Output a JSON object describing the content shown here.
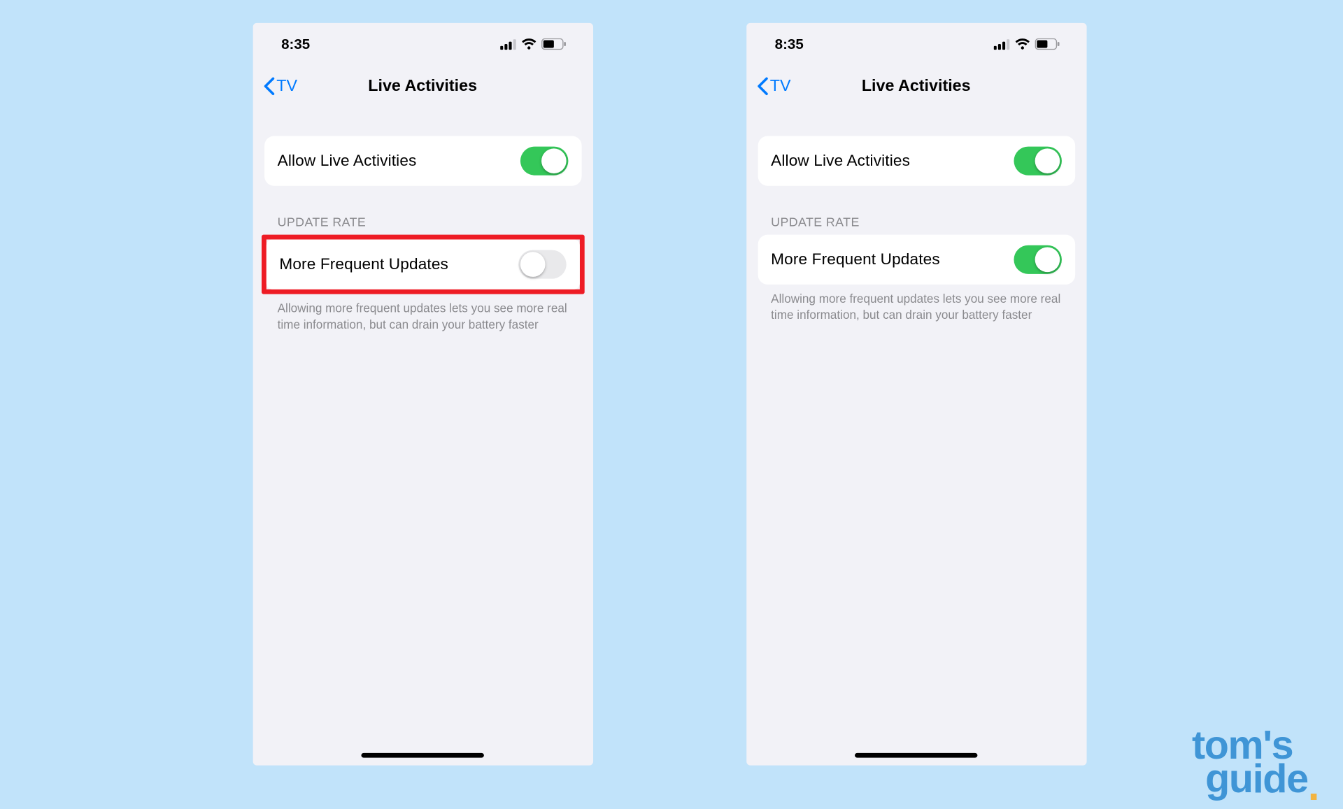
{
  "status": {
    "time": "8:35"
  },
  "nav": {
    "back_label": "TV",
    "title": "Live Activities"
  },
  "settings": {
    "allow_label": "Allow Live Activities",
    "section_header": "UPDATE RATE",
    "freq_label": "More Frequent Updates",
    "footnote": "Allowing more frequent updates lets you see more real time information, but can drain your battery faster"
  },
  "screens": {
    "left": {
      "allow_on": true,
      "freq_on": false,
      "highlight_freq": true
    },
    "right": {
      "allow_on": true,
      "freq_on": true,
      "highlight_freq": false
    }
  },
  "watermark": {
    "line1": "tom's",
    "line2": "guide"
  }
}
